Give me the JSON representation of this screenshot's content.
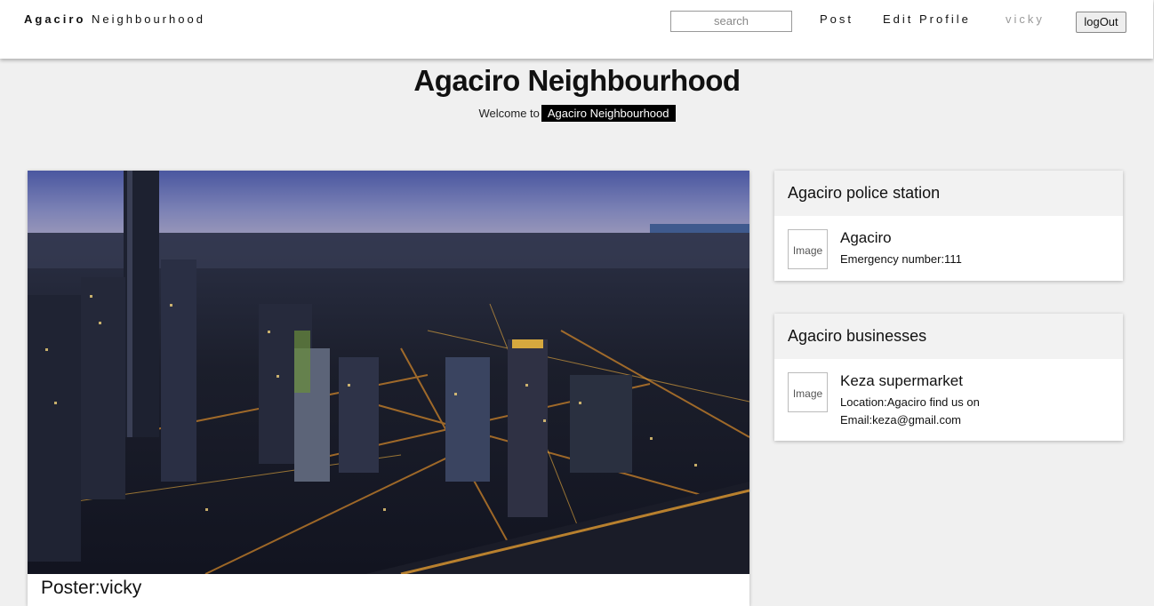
{
  "navbar": {
    "brand_bold": "Agaciro",
    "brand_rest": " Neighbourhood",
    "search_placeholder": "search",
    "links": {
      "post": "Post",
      "edit_profile": "Edit Profile",
      "user": "vicky"
    },
    "logout_label": "logOut"
  },
  "hero": {
    "title": "Agaciro Neighbourhood",
    "welcome_prefix": "Welcome to",
    "welcome_highlight": "Agaciro Neighbourhood"
  },
  "post": {
    "poster_label": "Poster:vicky"
  },
  "police": {
    "title": "Agaciro police station",
    "image_alt": "Image",
    "name": "Agaciro",
    "emergency": "Emergency number:111"
  },
  "businesses": {
    "title": "Agaciro businesses",
    "image_alt": "Image",
    "name": "Keza supermarket",
    "location": "Location:Agaciro find us on",
    "email": "Email:keza@gmail.com"
  }
}
